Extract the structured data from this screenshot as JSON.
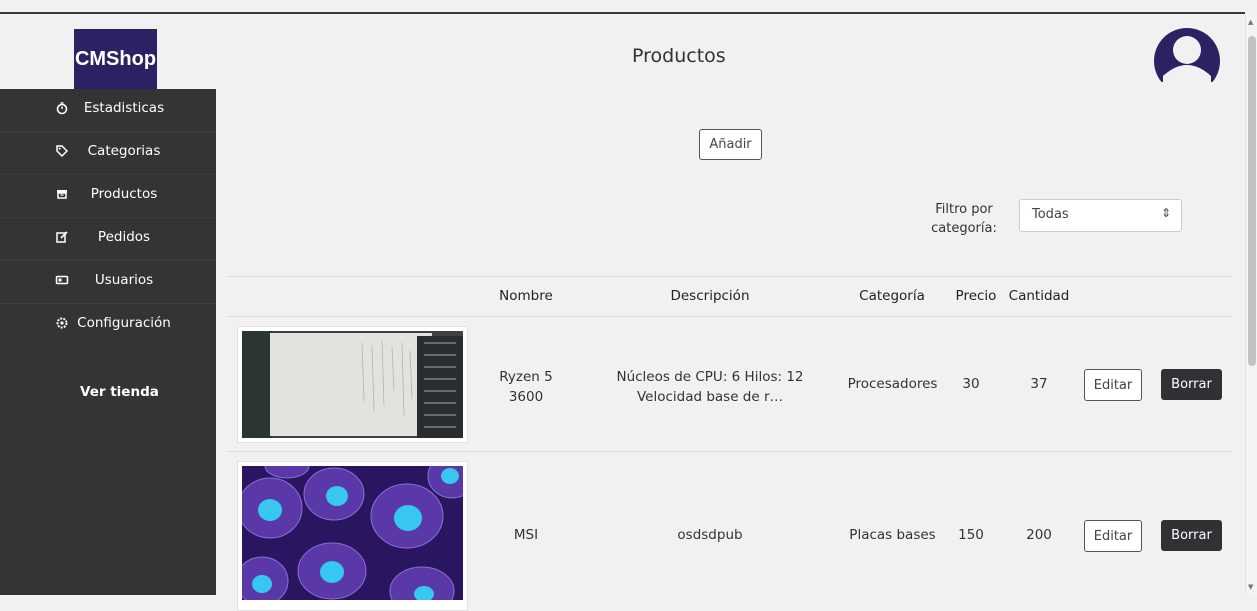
{
  "app": {
    "logo": "CMShop",
    "page_title": "Productos"
  },
  "sidebar": {
    "items": [
      {
        "label": "Estadisticas",
        "icon": "stopwatch-icon"
      },
      {
        "label": "Categorias",
        "icon": "tag-icon"
      },
      {
        "label": "Productos",
        "icon": "archive-icon"
      },
      {
        "label": "Pedidos",
        "icon": "edit-icon"
      },
      {
        "label": "Usuarios",
        "icon": "id-card-icon"
      },
      {
        "label": "Configuración",
        "icon": "gear-icon"
      }
    ],
    "view_store": "Ver tienda"
  },
  "toolbar": {
    "add_label": "Añadir"
  },
  "filter": {
    "label": "Filtro por categoría:",
    "selected": "Todas"
  },
  "table": {
    "headers": [
      "Nombre",
      "Descripción",
      "Categoría",
      "Precio",
      "Cantidad"
    ],
    "rows": [
      {
        "name": "Ryzen 5 3600",
        "description": "Núcleos de CPU: 6 Hilos: 12 Velocidad base de r…",
        "category": "Procesadores",
        "price": "30",
        "quantity": "37",
        "edit": "Editar",
        "delete": "Borrar"
      },
      {
        "name": "MSI",
        "description": "osdsdpub",
        "category": "Placas bases",
        "price": "150",
        "quantity": "200",
        "edit": "Editar",
        "delete": "Borrar"
      }
    ]
  },
  "colors": {
    "sidebar": "#333436",
    "logo_bg": "#2c2162",
    "avatar": "#2c2162",
    "dark_button": "#2f3134"
  }
}
